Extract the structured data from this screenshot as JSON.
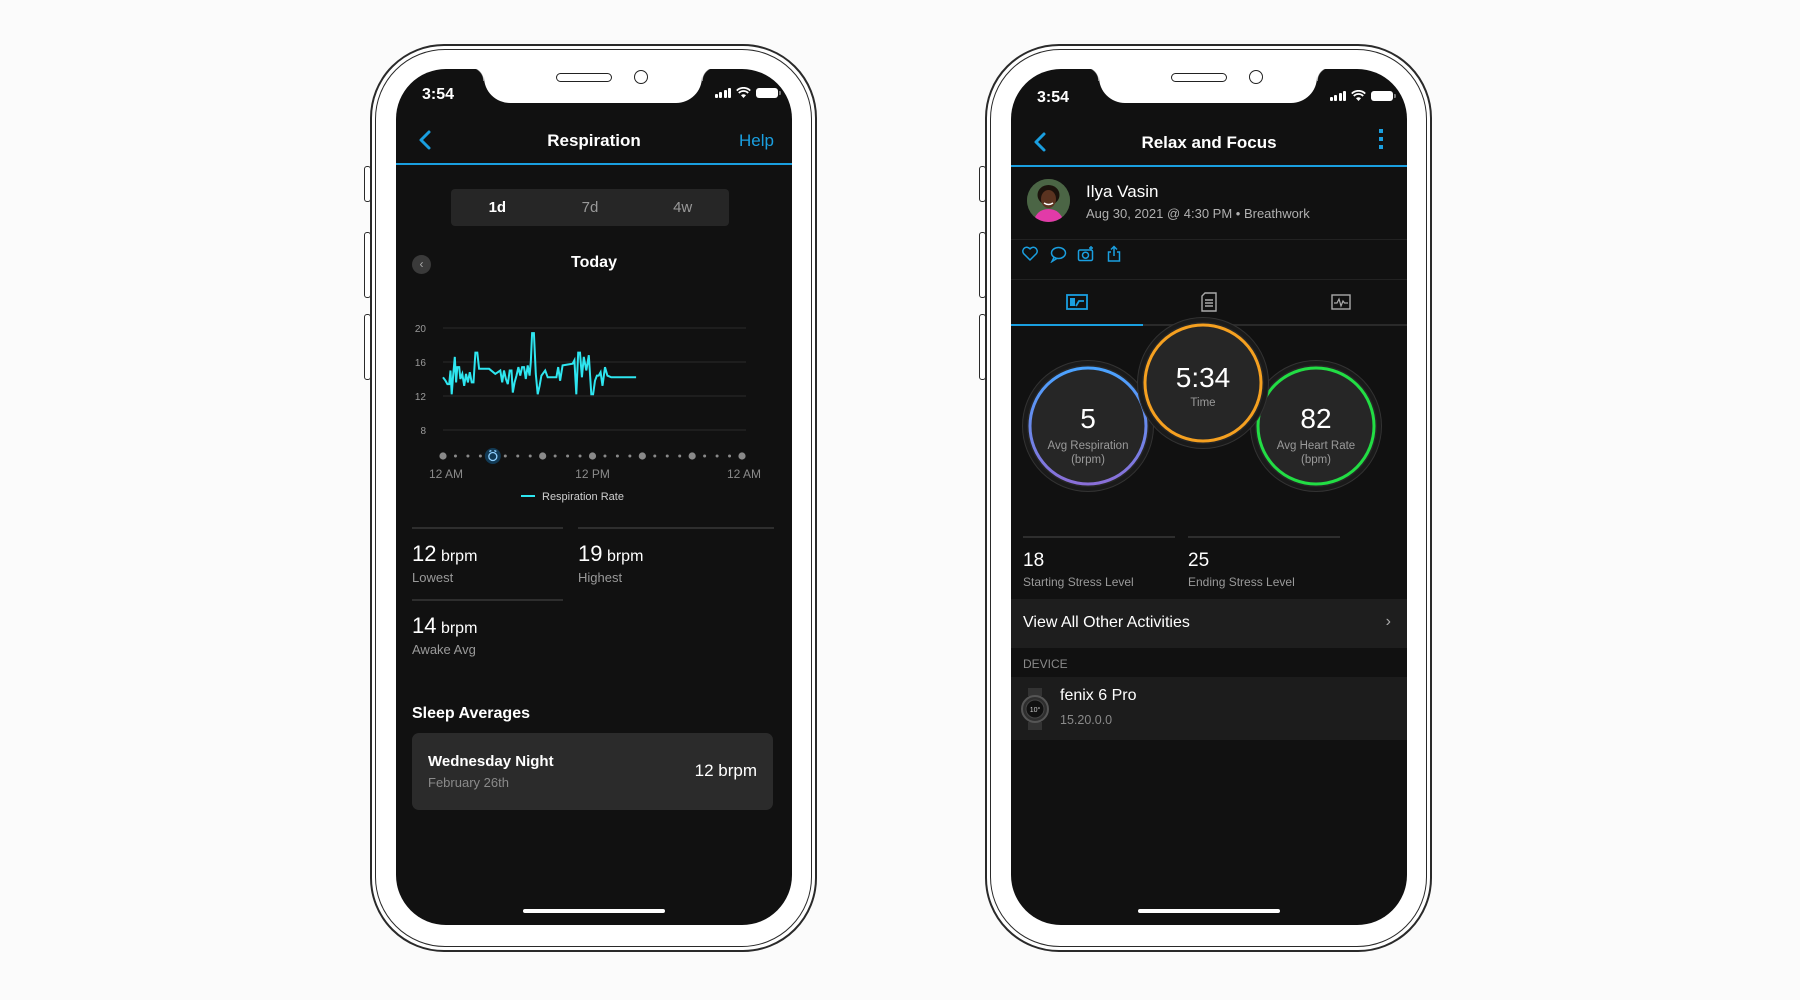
{
  "colors": {
    "accent": "#1a9fe0",
    "chart_line": "#2ee6f0",
    "respiration_ring": "#4aa3ff",
    "respiration_ring_end": "#8a6fd8",
    "time_ring": "#f5a020",
    "heart_ring": "#22dd44",
    "background": "#111111"
  },
  "left_phone": {
    "status": {
      "time": "3:54"
    },
    "nav": {
      "title": "Respiration",
      "back_icon": "chevron-left-icon",
      "help_label": "Help"
    },
    "segments": [
      {
        "label": "1d",
        "active": true
      },
      {
        "label": "7d",
        "active": false
      },
      {
        "label": "4w",
        "active": false
      }
    ],
    "day_label": "Today",
    "stats": [
      {
        "value": "12",
        "unit": "brpm",
        "label": "Lowest"
      },
      {
        "value": "19",
        "unit": "brpm",
        "label": "Highest"
      },
      {
        "value": "14",
        "unit": "brpm",
        "label": "Awake Avg"
      }
    ],
    "sleep_section_title": "Sleep Averages",
    "sleep_card": {
      "title": "Wednesday Night",
      "subtitle": "February 26th",
      "value": "12 brpm"
    }
  },
  "chart_data": {
    "type": "line",
    "title": "",
    "xlabel": "",
    "ylabel": "",
    "ylim": [
      8,
      20
    ],
    "yticks": [
      20,
      16,
      12,
      8
    ],
    "xlim_hours": [
      0,
      24
    ],
    "xtick_labels": [
      "12 AM",
      "12 PM",
      "12 AM"
    ],
    "xtick_hours": [
      0,
      12,
      24
    ],
    "grid": true,
    "legend": {
      "position": "bottom",
      "entries": [
        "Respiration Rate"
      ]
    },
    "timeline": {
      "major_every_hours": 4,
      "alarm_hour": 4
    },
    "series": [
      {
        "name": "Respiration Rate",
        "x_hours": [
          0.0,
          0.2,
          0.35,
          0.5,
          0.6,
          0.7,
          0.8,
          0.95,
          1.05,
          1.15,
          1.3,
          1.4,
          1.55,
          1.7,
          1.85,
          2.0,
          2.15,
          2.3,
          2.45,
          2.6,
          2.75,
          2.9,
          3.0,
          3.1,
          3.3,
          3.5,
          3.7,
          4.2,
          4.6,
          4.75,
          4.9,
          5.05,
          5.2,
          5.35,
          5.5,
          5.6,
          5.75,
          5.9,
          6.05,
          6.2,
          6.35,
          6.5,
          6.65,
          6.8,
          6.95,
          7.05,
          7.15,
          7.3,
          7.45,
          7.6,
          7.75,
          7.9,
          8.2,
          8.4,
          8.55,
          8.7,
          8.9,
          9.1,
          9.25,
          9.4,
          9.6,
          10.4,
          10.55,
          10.7,
          10.85,
          11.0,
          11.15,
          11.3,
          11.5,
          11.7,
          11.9,
          12.05,
          12.2,
          12.35,
          12.5,
          12.65,
          12.8,
          13.0,
          13.2,
          13.5,
          13.7,
          13.9,
          14.05,
          14.2,
          14.35,
          14.5,
          14.65,
          14.8,
          14.95,
          15.2,
          15.5
        ],
        "values": [
          14.2,
          13.8,
          13.4,
          13.4,
          15.0,
          12.2,
          14.2,
          16.6,
          13.6,
          15.4,
          15.4,
          14.0,
          14.6,
          13.2,
          14.6,
          13.6,
          14.8,
          13.6,
          13.6,
          17.1,
          17.1,
          15.2,
          15.2,
          15.2,
          15.2,
          15.2,
          15.2,
          14.6,
          15.0,
          13.6,
          15.0,
          14.0,
          13.4,
          15.0,
          15.0,
          12.4,
          13.6,
          14.4,
          15.4,
          14.4,
          15.4,
          15.4,
          14.0,
          15.6,
          14.4,
          16.0,
          19.4,
          19.4,
          14.6,
          12.2,
          13.2,
          14.4,
          15.0,
          14.2,
          14.2,
          14.2,
          14.2,
          14.2,
          15.4,
          13.8,
          15.6,
          15.8,
          16.2,
          12.2,
          17.1,
          17.1,
          14.2,
          16.6,
          15.0,
          16.8,
          12.2,
          12.2,
          13.8,
          14.4,
          14.4,
          14.8,
          13.2,
          15.4,
          14.4,
          14.2,
          14.2,
          14.2,
          14.2,
          14.2,
          14.2,
          14.2,
          14.2,
          14.2,
          14.2,
          14.2,
          14.2
        ]
      }
    ]
  },
  "right_phone": {
    "status": {
      "time": "3:54"
    },
    "nav": {
      "title": "Relax and Focus",
      "back_icon": "chevron-left-icon",
      "menu_icon": "kebab-menu-icon"
    },
    "profile": {
      "name": "Ilya Vasin",
      "subtitle": "Aug 30, 2021 @ 4:30 PM • Breathwork"
    },
    "actions": [
      "heart-icon",
      "comment-icon",
      "add-photo-icon",
      "share-icon"
    ],
    "tabs": [
      {
        "icon": "stats-tab-icon",
        "active": true
      },
      {
        "icon": "details-tab-icon",
        "active": false
      },
      {
        "icon": "chart-tab-icon",
        "active": false
      }
    ],
    "rings": [
      {
        "value": "5",
        "label1": "Avg Respiration",
        "label2": "(brpm)"
      },
      {
        "value": "5:34",
        "label1": "Time",
        "label2": ""
      },
      {
        "value": "82",
        "label1": "Avg Heart Rate",
        "label2": "(bpm)"
      }
    ],
    "stress": [
      {
        "value": "18",
        "label": "Starting Stress Level"
      },
      {
        "value": "25",
        "label": "Ending Stress Level"
      }
    ],
    "view_all_label": "View All Other Activities",
    "device_section_label": "DEVICE",
    "device": {
      "name": "fenix 6 Pro",
      "version": "15.20.0.0",
      "icon": "watch-icon"
    }
  }
}
